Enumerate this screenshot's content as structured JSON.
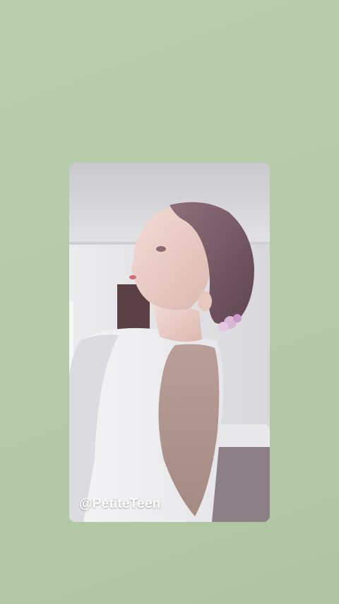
{
  "background_color": "#b6cba8",
  "story_card": {
    "watermark_text": "@PetiteTeen",
    "photo_description_icon": "photo"
  }
}
